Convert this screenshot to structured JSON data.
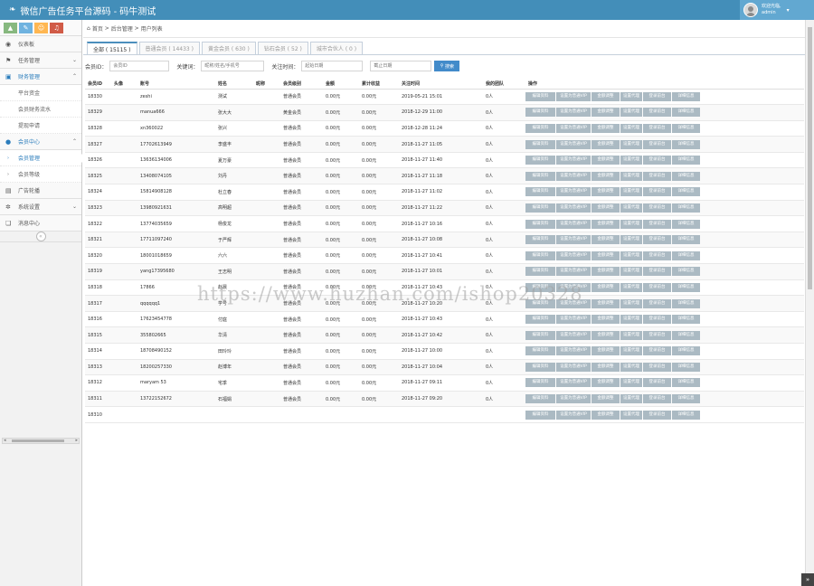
{
  "header": {
    "title": "微信广告任务平台源码 - 码牛测试",
    "user_line1": "欢迎光临,",
    "user_line2": "admin"
  },
  "shortcuts": [
    {
      "icon": "stats-icon",
      "color": "#87b87f",
      "glyph": "▲"
    },
    {
      "icon": "pencil-icon",
      "color": "#6fb3e0",
      "glyph": "✎"
    },
    {
      "icon": "group-icon",
      "color": "#ffb752",
      "glyph": "☺"
    },
    {
      "icon": "bell-icon",
      "color": "#d15b47",
      "glyph": "♫"
    }
  ],
  "sidebar": {
    "items": [
      {
        "label": "仪表板",
        "icon": "dashboard-icon",
        "glyph": "◉",
        "arrow": ""
      },
      {
        "label": "任务管理",
        "icon": "flag-icon",
        "glyph": "⚑",
        "arrow": "⌄"
      },
      {
        "label": "财务管理",
        "icon": "money-icon",
        "glyph": "▣",
        "arrow": "⌃"
      }
    ],
    "finance_sub": [
      "平台资金",
      "会员财务流水",
      "提现申请"
    ],
    "member_group": {
      "label": "会员中心",
      "icon": "user-icon",
      "glyph": "●",
      "arrow": "⌃"
    },
    "member_sub": [
      "会员管理",
      "会员等级"
    ],
    "bottom_items": [
      {
        "label": "广告轮播",
        "icon": "picture-icon",
        "glyph": "▤",
        "arrow": ""
      },
      {
        "label": "系统设置",
        "icon": "cog-icon",
        "glyph": "✲",
        "arrow": "⌄"
      },
      {
        "label": "消息中心",
        "icon": "bookmark-icon",
        "glyph": "❏",
        "arrow": ""
      }
    ],
    "collapse": "«"
  },
  "breadcrumb": {
    "home": "首页",
    "sep": ">",
    "parent": "后台管理",
    "current": "用户列表"
  },
  "tabs": [
    "全部 ( 15115 )",
    "普通会员 ( 14433 )",
    "黄金会员 ( 630 )",
    "钻石会员 ( 52 )",
    "城市合伙人 ( 0 )"
  ],
  "filter": {
    "id_label": "会员ID：",
    "id_placeholder": "会员ID",
    "kw_label": "关键词：",
    "kw_placeholder": "昵称/姓名/手机号",
    "time_label": "关注时间：",
    "start_placeholder": "起始日期",
    "end_placeholder": "截止日期",
    "search_label": "搜索"
  },
  "table": {
    "headers": [
      "会员ID",
      "头像",
      "账号",
      "姓名",
      "昵称",
      "会员级别",
      "金额",
      "累计收益",
      "关注时间",
      "我的团队",
      "操作"
    ],
    "ops": [
      "编辑资料",
      "设置为普通VIP",
      "金额调整",
      "设置代理",
      "登录前台",
      "详细信息"
    ],
    "rows": [
      [
        "18330",
        "",
        "zeshi",
        "测试",
        "",
        "普通会员",
        "0.00元",
        "0.00元",
        "2019-05-21 15:01",
        "0人"
      ],
      [
        "18329",
        "",
        "manua666",
        "张大大",
        "",
        "黄金会员",
        "0.00元",
        "0.00元",
        "2018-12-29 11:00",
        "0人"
      ],
      [
        "18328",
        "",
        "xn360022",
        "张兴",
        "",
        "普通会员",
        "0.00元",
        "0.00元",
        "2018-12-28 11:24",
        "0人"
      ],
      [
        "18327",
        "",
        "17702613949",
        "李盛丰",
        "",
        "普通会员",
        "0.00元",
        "0.00元",
        "2018-11-27 11:05",
        "0人"
      ],
      [
        "18326",
        "",
        "13636134006",
        "夏万豪",
        "",
        "普通会员",
        "0.00元",
        "0.00元",
        "2018-11-27 11:40",
        "0人"
      ],
      [
        "18325",
        "",
        "13408074105",
        "刘丹",
        "",
        "普通会员",
        "0.00元",
        "0.00元",
        "2018-11-27 11:18",
        "0人"
      ],
      [
        "18324",
        "",
        "15814908128",
        "杜立春",
        "",
        "普通会员",
        "0.00元",
        "0.00元",
        "2018-11-27 11:02",
        "0人"
      ],
      [
        "18323",
        "",
        "13980921631",
        "高明超",
        "",
        "普通会员",
        "0.00元",
        "0.00元",
        "2018-11-27 11:22",
        "0人"
      ],
      [
        "18322",
        "",
        "13774035659",
        "杨俊龙",
        "",
        "普通会员",
        "0.00元",
        "0.00元",
        "2018-11-27 10:16",
        "0人"
      ],
      [
        "18321",
        "",
        "17711097240",
        "于严辉",
        "",
        "普通会员",
        "0.00元",
        "0.00元",
        "2018-11-27 10:08",
        "0人"
      ],
      [
        "18320",
        "",
        "18001018659",
        "六六",
        "",
        "普通会员",
        "0.00元",
        "0.00元",
        "2018-11-27 10:41",
        "0人"
      ],
      [
        "18319",
        "",
        "yang17395680",
        "王志明",
        "",
        "普通会员",
        "0.00元",
        "0.00元",
        "2018-11-27 10:01",
        "0人"
      ],
      [
        "18318",
        "",
        "17866",
        "赵晨",
        "",
        "普通会员",
        "0.00元",
        "0.00元",
        "2018-11-27 10:43",
        "0人"
      ],
      [
        "18317",
        "",
        "qqqqqq1",
        "学号",
        "",
        "普通会员",
        "0.00元",
        "0.00元",
        "2018-11-27 10:20",
        "0人"
      ],
      [
        "18316",
        "",
        "17623454778",
        "付庭",
        "",
        "普通会员",
        "0.00元",
        "0.00元",
        "2018-11-27 10:43",
        "0人"
      ],
      [
        "18315",
        "",
        "355802665",
        "华清",
        "",
        "普通会员",
        "0.00元",
        "0.00元",
        "2018-11-27 10:42",
        "0人"
      ],
      [
        "18314",
        "",
        "18708490152",
        "田玲玲",
        "",
        "普通会员",
        "0.00元",
        "0.00元",
        "2018-11-27 10:00",
        "0人"
      ],
      [
        "18313",
        "",
        "18200257330",
        "赵博年",
        "",
        "普通会员",
        "0.00元",
        "0.00元",
        "2018-11-27 10:04",
        "0人"
      ],
      [
        "18312",
        "",
        "maryam 53",
        "宅季",
        "",
        "普通会员",
        "0.00元",
        "0.00元",
        "2018-11-27 09:11",
        "0人"
      ],
      [
        "18311",
        "",
        "13722152672",
        "石福娟",
        "",
        "普通会员",
        "0.00元",
        "0.00元",
        "2018-11-27 09:20",
        "0人"
      ],
      [
        "18310",
        "",
        "",
        "",
        "",
        "",
        "",
        "",
        "",
        ""
      ]
    ]
  },
  "watermark": "https://www.huzhan.com/ishop20328",
  "corner_btn": "»"
}
